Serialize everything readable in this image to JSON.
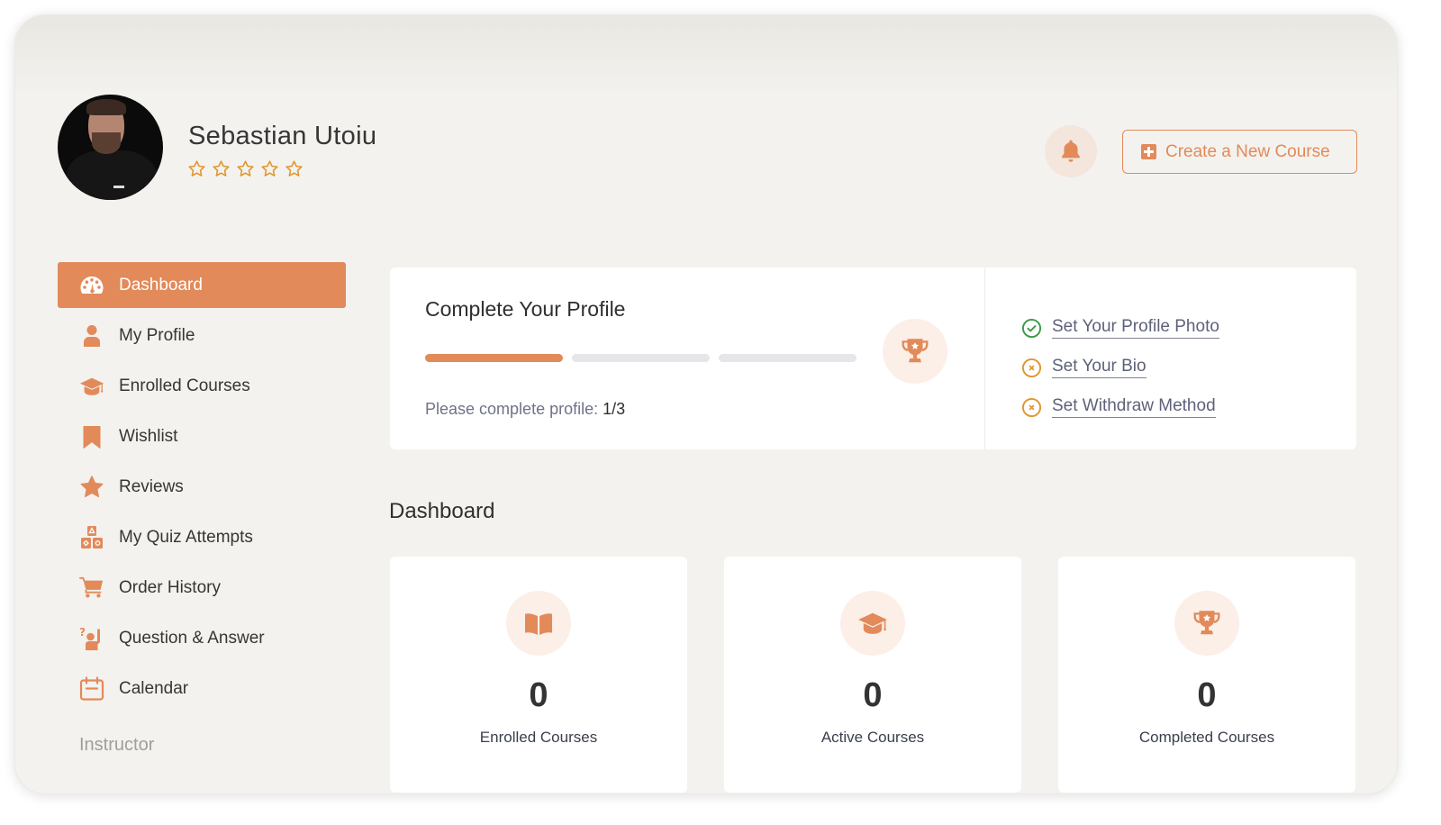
{
  "user": {
    "name": "Sebastian Utoiu",
    "rating": {
      "value": 0,
      "max": 5
    }
  },
  "header": {
    "notification_icon": "bell-icon",
    "create_button_label": "Create a New Course",
    "create_button_icon": "plus-square-icon"
  },
  "colors": {
    "accent": "#e28a5a",
    "accent_soft": "#fbefe8",
    "background": "#f4f2ee",
    "success": "#3a9a48",
    "warning": "#e0962e",
    "link_text": "#5d6279"
  },
  "sidebar": {
    "items": [
      {
        "label": "Dashboard",
        "icon": "dashboard-gauge-icon",
        "active": true
      },
      {
        "label": "My Profile",
        "icon": "user-icon",
        "active": false
      },
      {
        "label": "Enrolled Courses",
        "icon": "graduation-cap-icon",
        "active": false
      },
      {
        "label": "Wishlist",
        "icon": "bookmark-icon",
        "active": false
      },
      {
        "label": "Reviews",
        "icon": "star-icon",
        "active": false
      },
      {
        "label": "My Quiz Attempts",
        "icon": "quiz-blocks-icon",
        "active": false
      },
      {
        "label": "Order History",
        "icon": "cart-icon",
        "active": false
      },
      {
        "label": "Question & Answer",
        "icon": "question-hand-icon",
        "active": false
      },
      {
        "label": "Calendar",
        "icon": "calendar-icon",
        "active": false
      }
    ],
    "section_label": "Instructor"
  },
  "profile_completion": {
    "title": "Complete Your Profile",
    "steps_total": 3,
    "steps_done": 1,
    "hint_label": "Please complete profile:",
    "hint_value": "1/3",
    "icon": "trophy-icon",
    "tasks": [
      {
        "label": "Set Your Profile Photo",
        "status": "done",
        "icon": "check-circle-icon"
      },
      {
        "label": "Set Your Bio",
        "status": "pending",
        "icon": "x-circle-icon"
      },
      {
        "label": "Set Withdraw Method",
        "status": "pending",
        "icon": "x-circle-icon"
      }
    ]
  },
  "dashboard": {
    "title": "Dashboard",
    "stats": [
      {
        "value": "0",
        "label": "Enrolled Courses",
        "icon": "open-book-icon"
      },
      {
        "value": "0",
        "label": "Active Courses",
        "icon": "graduation-cap-icon"
      },
      {
        "value": "0",
        "label": "Completed Courses",
        "icon": "trophy-icon"
      }
    ]
  }
}
